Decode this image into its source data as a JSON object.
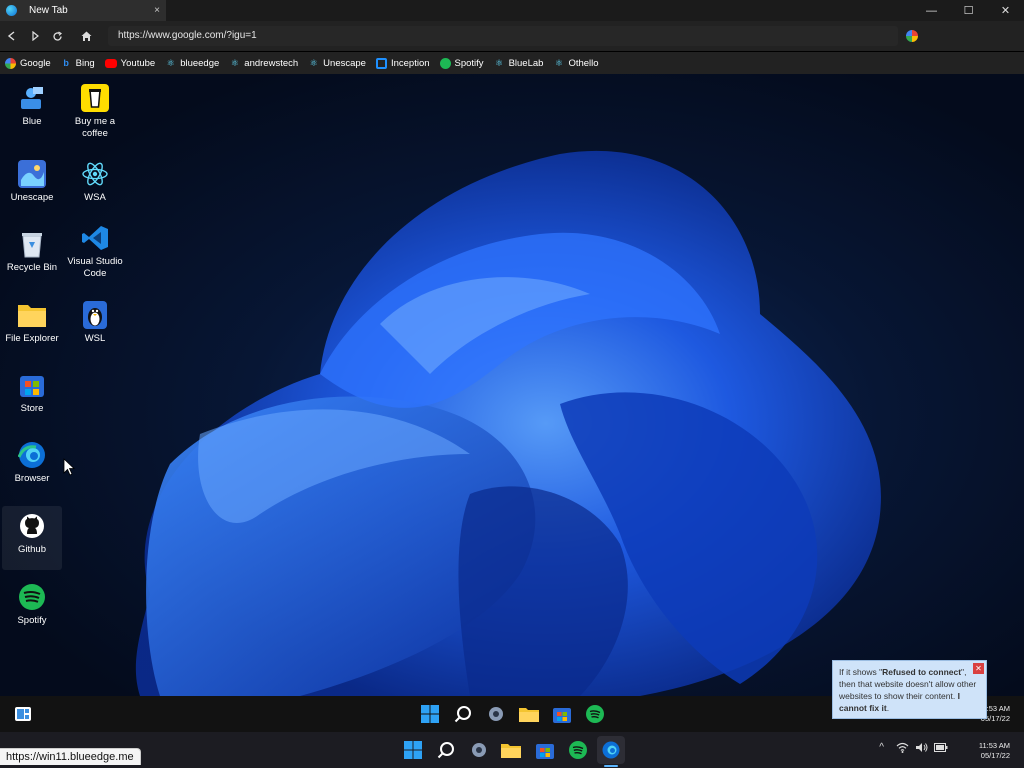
{
  "browser": {
    "tab_title": "New Tab",
    "tab_close": "×",
    "window_controls": {
      "minimize": "—",
      "maximize": "☐",
      "close": "✕"
    },
    "url": "https://www.google.com/?igu=1"
  },
  "bookmarks": [
    {
      "label": "Google",
      "icon": "google-icon",
      "color": "#ffffff"
    },
    {
      "label": "Bing",
      "icon": "bing-icon",
      "color": "#2e8cf0"
    },
    {
      "label": "Youtube",
      "icon": "youtube-icon",
      "color": "#ff0000"
    },
    {
      "label": "blueedge",
      "icon": "react-icon",
      "color": "#61dafb"
    },
    {
      "label": "andrewstech",
      "icon": "react-icon",
      "color": "#61dafb"
    },
    {
      "label": "Unescape",
      "icon": "react-icon",
      "color": "#61dafb"
    },
    {
      "label": "Inception",
      "icon": "inception-icon",
      "color": "#1e90ff"
    },
    {
      "label": "Spotify",
      "icon": "spotify-icon",
      "color": "#1db954"
    },
    {
      "label": "BlueLab",
      "icon": "react-icon",
      "color": "#61dafb"
    },
    {
      "label": "Othello",
      "icon": "react-icon",
      "color": "#61dafb"
    }
  ],
  "desktop_icons": [
    {
      "label": "Blue",
      "icon": "user-icon"
    },
    {
      "label": "Buy me a coffee",
      "icon": "coffee-icon"
    },
    {
      "label": "Unescape",
      "icon": "unescape-icon"
    },
    {
      "label": "WSA",
      "icon": "react-icon"
    },
    {
      "label": "Recycle Bin",
      "icon": "recycle-bin-icon"
    },
    {
      "label": "Visual Studio Code",
      "icon": "vscode-icon"
    },
    {
      "label": "File Explorer",
      "icon": "folder-icon"
    },
    {
      "label": "WSL",
      "icon": "penguin-icon"
    },
    {
      "label": "Store",
      "icon": "store-icon"
    },
    {
      "label": "Browser",
      "icon": "edge-icon"
    },
    {
      "label": "Github",
      "icon": "github-icon"
    },
    {
      "label": "Spotify",
      "icon": "spotify-icon"
    }
  ],
  "tooltip": {
    "pre": "If it shows \"",
    "strong1": "Refused to connect",
    "mid": "\", then that website doesn't allow other websites to show their content. ",
    "strong2": "I cannot fix it",
    "post": "."
  },
  "web_clock": {
    "time": "11:53 AM",
    "date": "05/17/22"
  },
  "real_clock": {
    "time": "11:53 AM",
    "date": "05/17/22"
  },
  "status_url": "https://win11.blueedge.me",
  "tray": {
    "chevron": "^",
    "wifi": "wifi-icon",
    "volume": "volume-icon",
    "battery": "battery-icon"
  }
}
